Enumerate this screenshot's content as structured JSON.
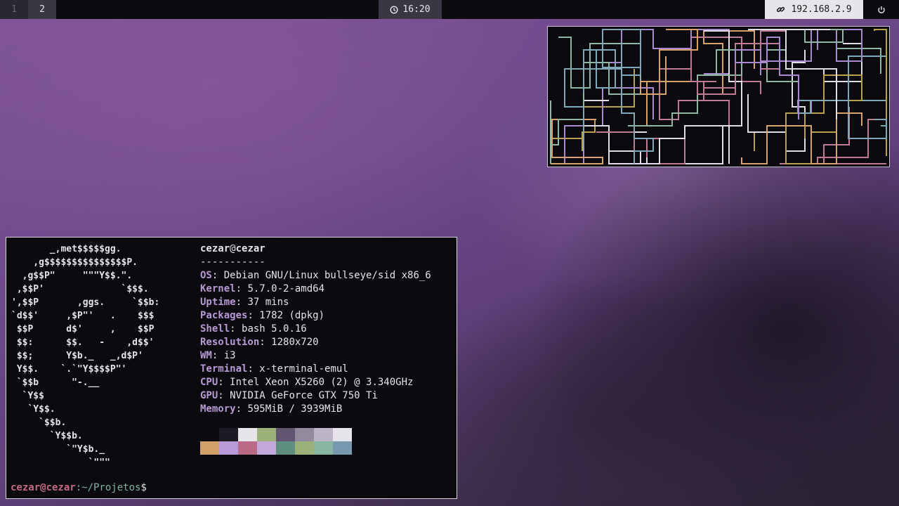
{
  "bar": {
    "workspaces": [
      "1",
      "2"
    ],
    "clock": "16:20",
    "network_ip": "192.168.2.9",
    "icons": {
      "clock": "clock-icon",
      "network": "link-icon",
      "power": "power-icon"
    }
  },
  "terminal": {
    "logo_lines": [
      "       _,met$$$$$gg.",
      "    ,g$$$$$$$$$$$$$$$P.",
      "  ,g$$P\"     \"\"\"Y$$.\".",
      " ,$$P'              `$$$.",
      "',$$P       ,ggs.     `$$b:",
      "`d$$'     ,$P\"'   .    $$$",
      " $$P      d$'     ,    $$P",
      " $$:      $$.   -    ,d$$'",
      " $$;      Y$b._   _,d$P'",
      " Y$$.    `.`\"Y$$$$P\"'",
      " `$$b      \"-.__",
      "  `Y$$",
      "   `Y$$.",
      "     `$$b.",
      "       `Y$$b.",
      "          `\"Y$b._",
      "              `\"\"\""
    ],
    "user": "cezar",
    "host": "cezar",
    "separator": "-----------",
    "info": [
      {
        "key": "OS",
        "value": "Debian GNU/Linux bullseye/sid x86_6"
      },
      {
        "key": "Kernel",
        "value": "5.7.0-2-amd64"
      },
      {
        "key": "Uptime",
        "value": "37 mins"
      },
      {
        "key": "Packages",
        "value": "1782 (dpkg)"
      },
      {
        "key": "Shell",
        "value": "bash 5.0.16"
      },
      {
        "key": "Resolution",
        "value": "1280x720"
      },
      {
        "key": "WM",
        "value": "i3"
      },
      {
        "key": "Terminal",
        "value": "x-terminal-emul"
      },
      {
        "key": "CPU",
        "value": "Intel Xeon X5260 (2) @ 3.340GHz"
      },
      {
        "key": "GPU",
        "value": "NVIDIA GeForce GTX 750 Ti"
      },
      {
        "key": "Memory",
        "value": "595MiB / 3939MiB"
      }
    ],
    "palette_row1": [
      "#0b0a0e",
      "#1c1a22",
      "#e8e5ea",
      "#9cb07a",
      "#625570",
      "#938a9e",
      "#bdb4c6",
      "#e6e3ea"
    ],
    "palette_row2": [
      "#d2a06a",
      "#b89ad8",
      "#b86a86",
      "#c3a8dc",
      "#5e8e80",
      "#9cb07a",
      "#88b6a0",
      "#7898ae"
    ],
    "prompt": {
      "user_host": "cezar@cezar",
      "path": ":~/Projetos",
      "symbol": "$"
    }
  },
  "pipes_colors": [
    "#8fb8a4",
    "#c07a94",
    "#a98ad0",
    "#d7a26c",
    "#7fa9b8",
    "#b9a24a",
    "#e2dbe8"
  ]
}
